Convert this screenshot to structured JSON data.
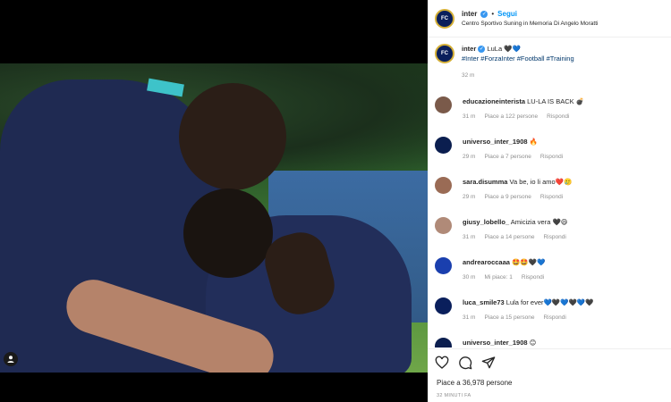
{
  "header": {
    "username": "inter",
    "follow_label": "Segui",
    "dot": "•",
    "location": "Centro Sportivo Suning in Memoria Di Angelo Moratti"
  },
  "caption": {
    "username": "inter",
    "text": "LuLa 🖤💙",
    "hashtags": "#Inter #ForzaInter #Football #Training",
    "time": "32 m"
  },
  "comments": [
    {
      "user": "educazioneinterista",
      "text": "LU-LA IS BACK 💣",
      "time": "31 m",
      "likes": "Piace a 122 persone",
      "reply": "Rispondi",
      "avatar_color": "#7a5a4a"
    },
    {
      "user": "universo_inter_1908",
      "text": "🔥",
      "time": "29 m",
      "likes": "Piace a 7 persone",
      "reply": "Rispondi",
      "avatar_color": "#0b1e4f"
    },
    {
      "user": "sara.disumma",
      "text": "Va be, io li amo❤️🥲",
      "time": "29 m",
      "likes": "Piace a 9 persone",
      "reply": "Rispondi",
      "avatar_color": "#9a6b55"
    },
    {
      "user": "giusy_lobello_",
      "text": "Amicizia vera 🖤😄",
      "time": "31 m",
      "likes": "Piace a 14 persone",
      "reply": "Rispondi",
      "avatar_color": "#b08a78"
    },
    {
      "user": "andrearoccaaa",
      "text": "🤩🤩🖤💙",
      "time": "30 m",
      "likes": "Mi piace: 1",
      "reply": "Rispondi",
      "avatar_color": "#1a3fae"
    },
    {
      "user": "luca_smile73",
      "text": "Lula for ever💙🖤💙🖤💙🖤",
      "time": "31 m",
      "likes": "Piace a 15 persone",
      "reply": "Rispondi",
      "avatar_color": "#0a1f5c"
    },
    {
      "user": "universo_inter_1908",
      "text": "😊",
      "time": "",
      "likes": "",
      "reply": "",
      "avatar_color": "#0b1e4f"
    }
  ],
  "footer": {
    "likes": "Piace a 36,978 persone",
    "posted": "32 MINUTI FA"
  },
  "icons": {
    "like": "heart-icon",
    "comment": "comment-icon",
    "share": "share-icon",
    "tag": "user-tag-icon"
  }
}
